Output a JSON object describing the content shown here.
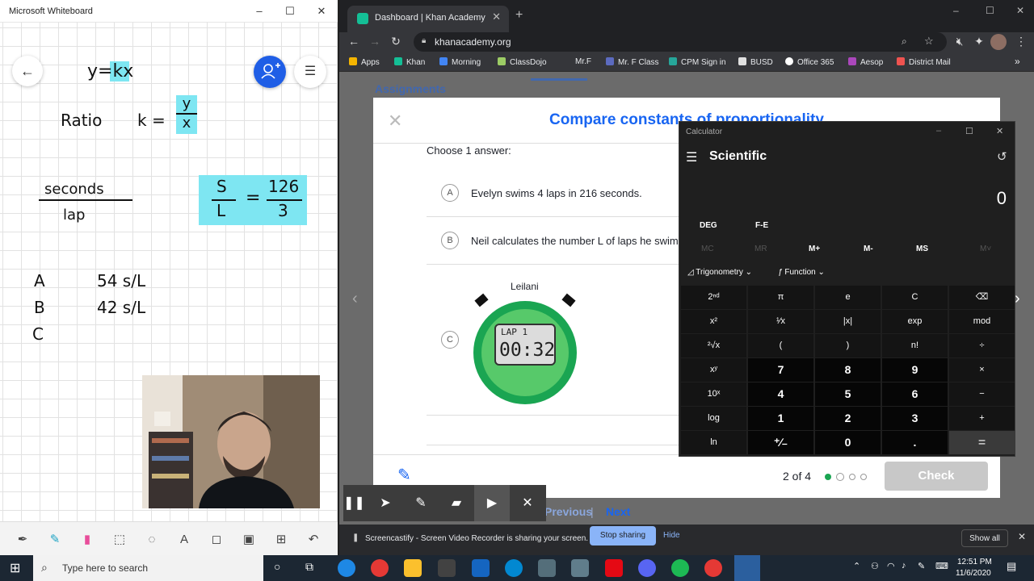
{
  "whiteboard": {
    "title": "Microsoft Whiteboard",
    "notes": {
      "formula": "y=kx",
      "ratio_label": "Ratio",
      "k_eq": "k =",
      "k_num": "y",
      "k_den": "x",
      "unit_num": "seconds",
      "unit_den": "lap",
      "left_num": "S",
      "left_den": "L",
      "equals": "=",
      "right_num": "126",
      "right_den": "3",
      "row_a_label": "A",
      "row_a_value": "54  s/L",
      "row_b_label": "B",
      "row_b_value": "42  s/L",
      "row_c_label": "C"
    },
    "toolbar_icons": [
      "pen-icon",
      "highlighter-icon",
      "eraser-icon",
      "lasso-icon",
      "ruler-icon",
      "text-icon",
      "note-icon",
      "image-icon",
      "add-icon",
      "undo-icon"
    ]
  },
  "browser": {
    "tab_title": "Dashboard | Khan Academy",
    "url": "khanacademy.org",
    "bookmarks": [
      {
        "label": "Apps",
        "color": "#f4b400"
      },
      {
        "label": "Khan",
        "color": "#14bf96"
      },
      {
        "label": "Morning",
        "color": "#4285f4"
      },
      {
        "label": "ClassDojo",
        "color": "#9ccc65"
      },
      {
        "label": "Mr.F",
        "color": "#35363a"
      },
      {
        "label": "Mr. F Class",
        "color": "#5c6bc0"
      },
      {
        "label": "CPM Sign in",
        "color": "#26a69a"
      },
      {
        "label": "BUSD",
        "color": "#e0e0e0"
      },
      {
        "label": "Office 365",
        "color": "#ffffff"
      },
      {
        "label": "Aesop",
        "color": "#ab47bc"
      },
      {
        "label": "District Mail",
        "color": "#ef5350"
      }
    ]
  },
  "page": {
    "behind_heading": "Assignments",
    "modal_title": "Compare constants of proportionality",
    "prompt": "Choose 1 answer:",
    "choices": [
      {
        "letter": "A",
        "text": "Evelyn swims 4 laps in 216 seconds."
      },
      {
        "letter": "B",
        "text": "Neil calculates the number L of laps he swims"
      },
      {
        "letter": "C",
        "caption": "Leilani",
        "lap": "LAP 1",
        "time": "00:32"
      }
    ],
    "progress": "2 of 4",
    "check_label": "Check",
    "previous_label": "Previous",
    "next_label": "Next"
  },
  "calculator": {
    "app_title": "Calculator",
    "mode": "Scientific",
    "display": "0",
    "deg_label": "DEG",
    "fe_label": "F-E",
    "memory": [
      "MC",
      "MR",
      "M+",
      "M-",
      "MS",
      "M˅"
    ],
    "trig_label": "Trigonometry",
    "function_label": "Function",
    "keys": [
      [
        "2ⁿᵈ",
        "π",
        "e",
        "C",
        "⌫"
      ],
      [
        "x²",
        "¹⁄x",
        "|x|",
        "exp",
        "mod"
      ],
      [
        "²√x",
        "(",
        ")",
        "n!",
        "÷"
      ],
      [
        "xʸ",
        "7",
        "8",
        "9",
        "×"
      ],
      [
        "10ˣ",
        "4",
        "5",
        "6",
        "−"
      ],
      [
        "log",
        "1",
        "2",
        "3",
        "+"
      ],
      [
        "ln",
        "⁺∕₋",
        "0",
        ".",
        "="
      ]
    ]
  },
  "screencastify": {
    "message": "Screencastify - Screen Video Recorder is sharing your screen.",
    "stop_label": "Stop sharing",
    "hide_label": "Hide",
    "show_all_label": "Show all"
  },
  "taskbar": {
    "search_placeholder": "Type here to search",
    "time": "12:51 PM",
    "date": "11/6/2020"
  }
}
